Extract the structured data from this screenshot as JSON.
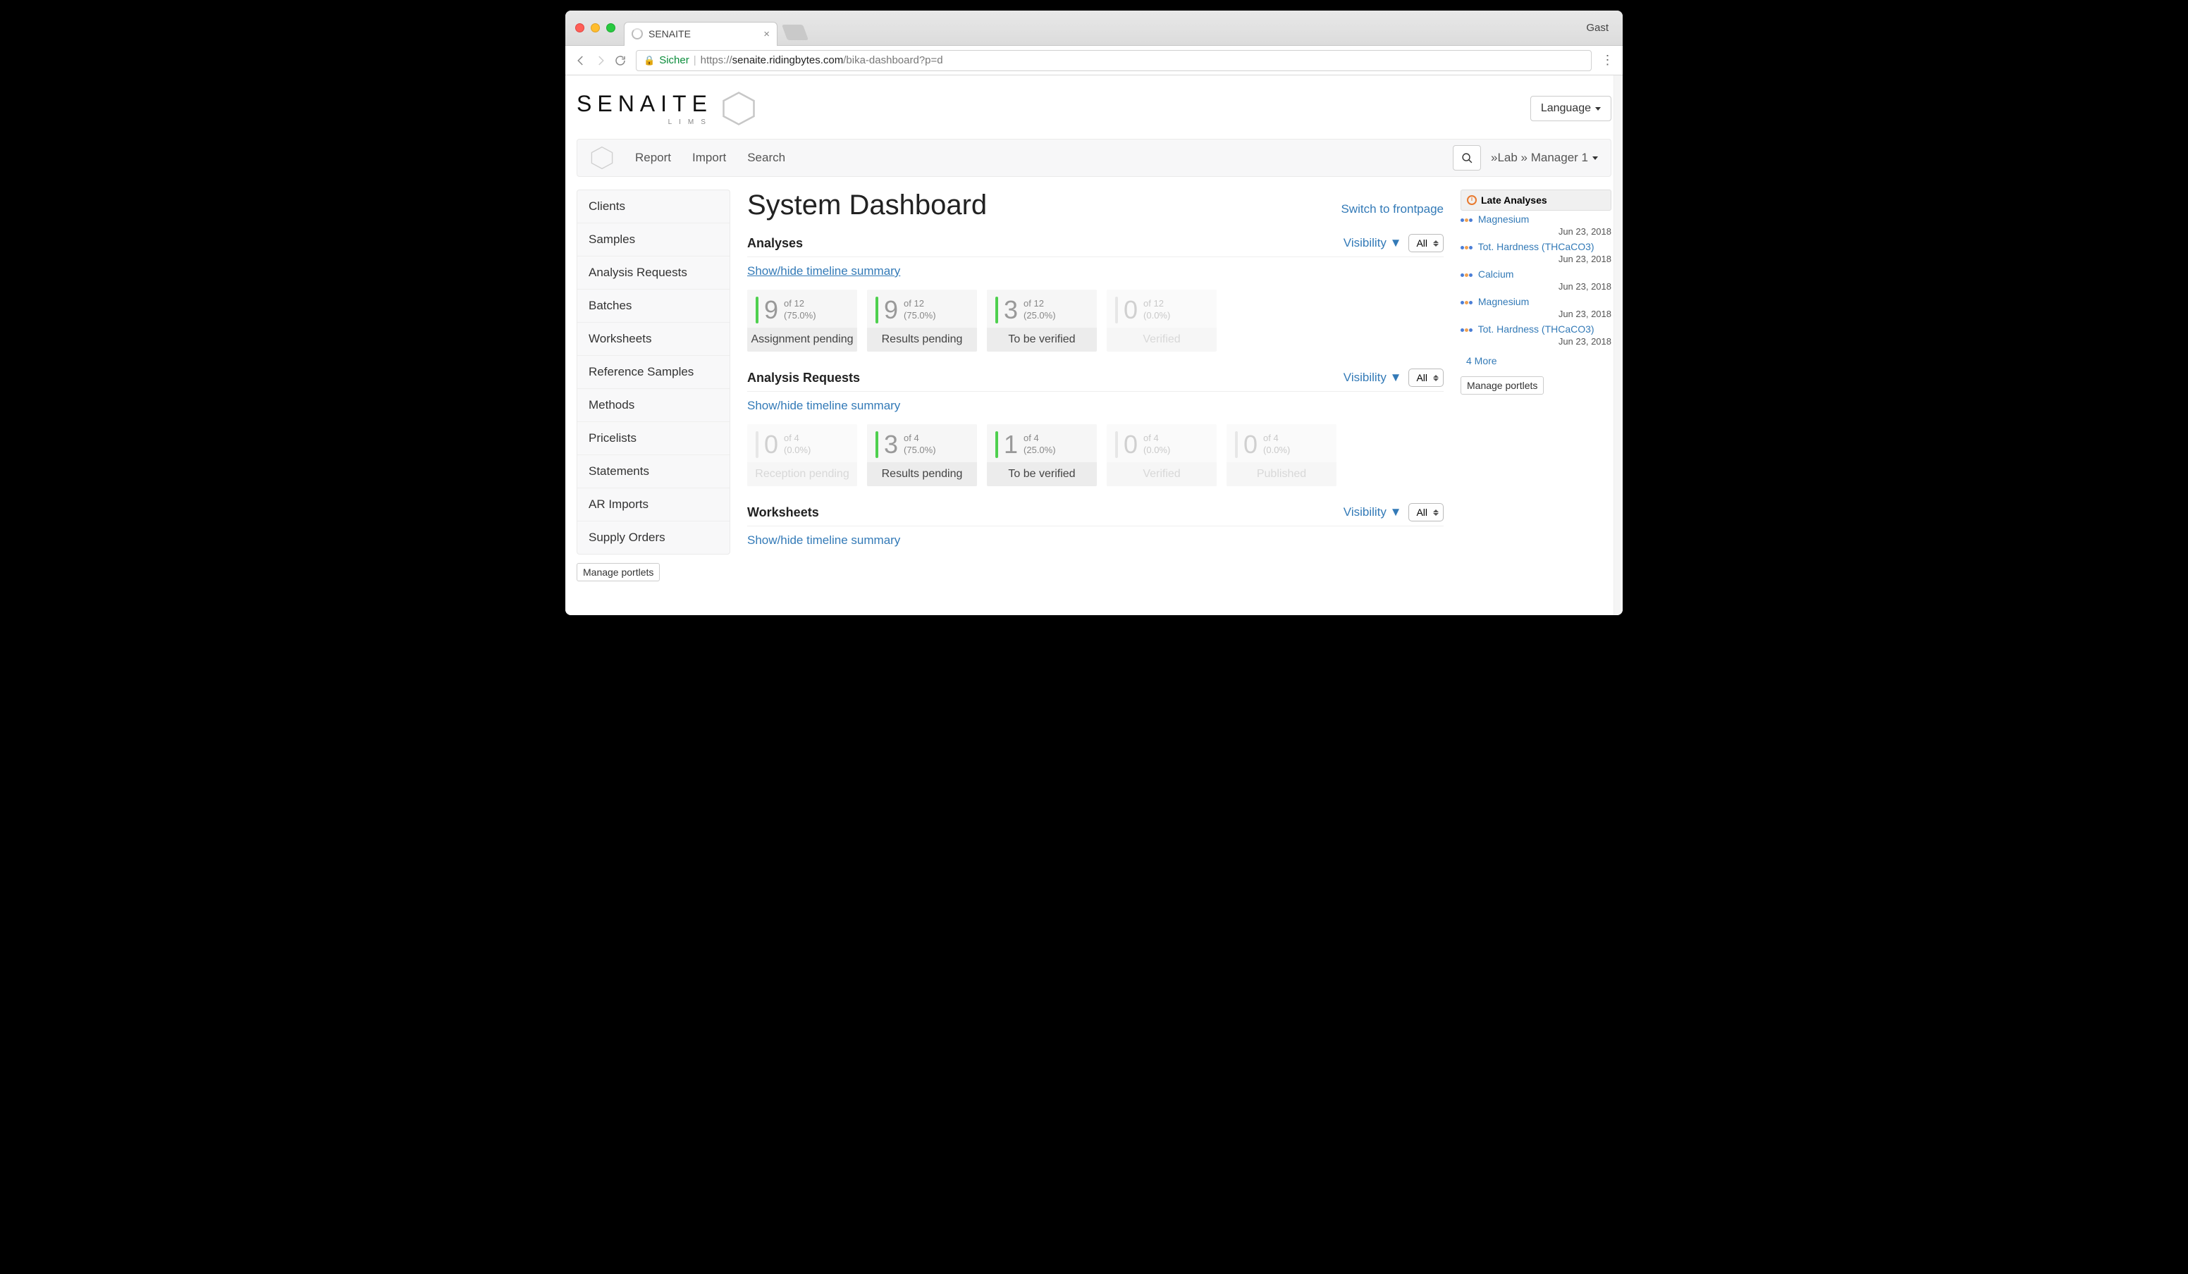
{
  "browser": {
    "tab_title": "SENAITE",
    "user_label": "Gast",
    "secure_label": "Sicher",
    "url_scheme": "https://",
    "url_domain": "senaite.ridingbytes.com",
    "url_path": "/bika-dashboard?p=d"
  },
  "header": {
    "logo_main": "SENAITE",
    "logo_sub": "LIMS",
    "language_label": "Language"
  },
  "menu": {
    "items": [
      "Report",
      "Import",
      "Search"
    ],
    "user": "»Lab » Manager 1"
  },
  "sidebar": {
    "items": [
      "Clients",
      "Samples",
      "Analysis Requests",
      "Batches",
      "Worksheets",
      "Reference Samples",
      "Methods",
      "Pricelists",
      "Statements",
      "AR Imports",
      "Supply Orders"
    ],
    "manage_label": "Manage portlets"
  },
  "main": {
    "title": "System Dashboard",
    "switch_label": "Switch to frontpage",
    "visibility_label": "Visibility",
    "select_value": "All",
    "showhide_label": "Show/hide timeline summary",
    "sections": [
      {
        "title": "Analyses",
        "cards": [
          {
            "num": "9",
            "of": "of 12",
            "pct": "(75.0%)",
            "label": "Assignment pending",
            "faded": false
          },
          {
            "num": "9",
            "of": "of 12",
            "pct": "(75.0%)",
            "label": "Results pending",
            "faded": false
          },
          {
            "num": "3",
            "of": "of 12",
            "pct": "(25.0%)",
            "label": "To be verified",
            "faded": false
          },
          {
            "num": "0",
            "of": "of 12",
            "pct": "(0.0%)",
            "label": "Verified",
            "faded": true
          }
        ]
      },
      {
        "title": "Analysis Requests",
        "cards": [
          {
            "num": "0",
            "of": "of 4",
            "pct": "(0.0%)",
            "label": "Reception pending",
            "faded": true
          },
          {
            "num": "3",
            "of": "of 4",
            "pct": "(75.0%)",
            "label": "Results pending",
            "faded": false
          },
          {
            "num": "1",
            "of": "of 4",
            "pct": "(25.0%)",
            "label": "To be verified",
            "faded": false
          },
          {
            "num": "0",
            "of": "of 4",
            "pct": "(0.0%)",
            "label": "Verified",
            "faded": true
          },
          {
            "num": "0",
            "of": "of 4",
            "pct": "(0.0%)",
            "label": "Published",
            "faded": true
          }
        ]
      },
      {
        "title": "Worksheets",
        "cards": []
      }
    ]
  },
  "right": {
    "portlet_title": "Late Analyses",
    "manage_label": "Manage portlets",
    "more_label": "4 More",
    "date": "Jun 23, 2018",
    "items": [
      "Magnesium",
      "Tot. Hardness (THCaCO3)",
      "Calcium",
      "Magnesium",
      "Tot. Hardness (THCaCO3)"
    ]
  }
}
